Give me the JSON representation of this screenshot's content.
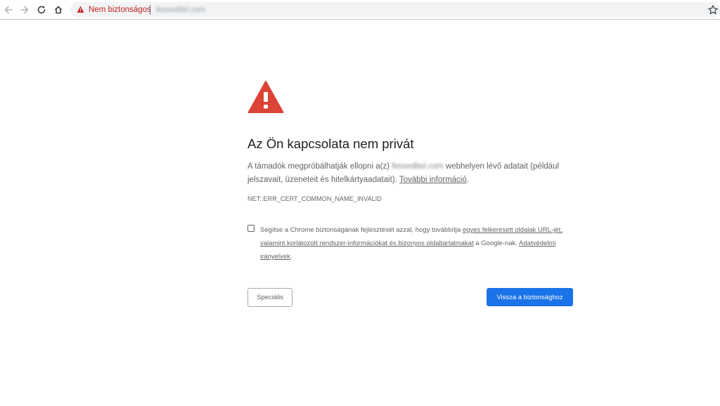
{
  "browser": {
    "security_label": "Nem biztonságos",
    "url": "fesseditel.com",
    "colors": {
      "toolbar_bg": "#ffffff",
      "omnibox_bg": "#f1f3f4",
      "warning_red": "#c5221f"
    },
    "icons": [
      "back-arrow-icon",
      "forward-arrow-icon",
      "reload-icon",
      "home-icon",
      "warning-triangle-icon",
      "star-icon"
    ]
  },
  "interstitial": {
    "title": "Az Ön kapcsolata nem privát",
    "description_prefix": "A támadók megpróbálhatják ellopni a(z) ",
    "description_domain": "fesseditel.com",
    "description_suffix": " webhelyen lévő adatait (például jelszavait, üzeneteit és hitelkártyaadatait). ",
    "more_info_link": "További információ",
    "description_end": ".",
    "error_code": "NET::ERR_CERT_COMMON_NAME_INVALID",
    "optin": {
      "text_before": "Segítse a Chrome biztonságának fejlesztését azzal, hogy továbbítja ",
      "link_reports": "egyes felkeresett oldalak URL-jét, valamint korlátozott rendszer-információkat és bizonyos oldaltartalmakat",
      "text_after": " a Google-nak. ",
      "link_privacy": "Adatvédelmi irányelvek",
      "text_end": "."
    },
    "buttons": {
      "advanced": "Speciális",
      "back_to_safety": "Vissza a biztonsághoz"
    },
    "colors": {
      "warning_icon": "#db4437",
      "primary_button": "#1a73e8"
    }
  }
}
